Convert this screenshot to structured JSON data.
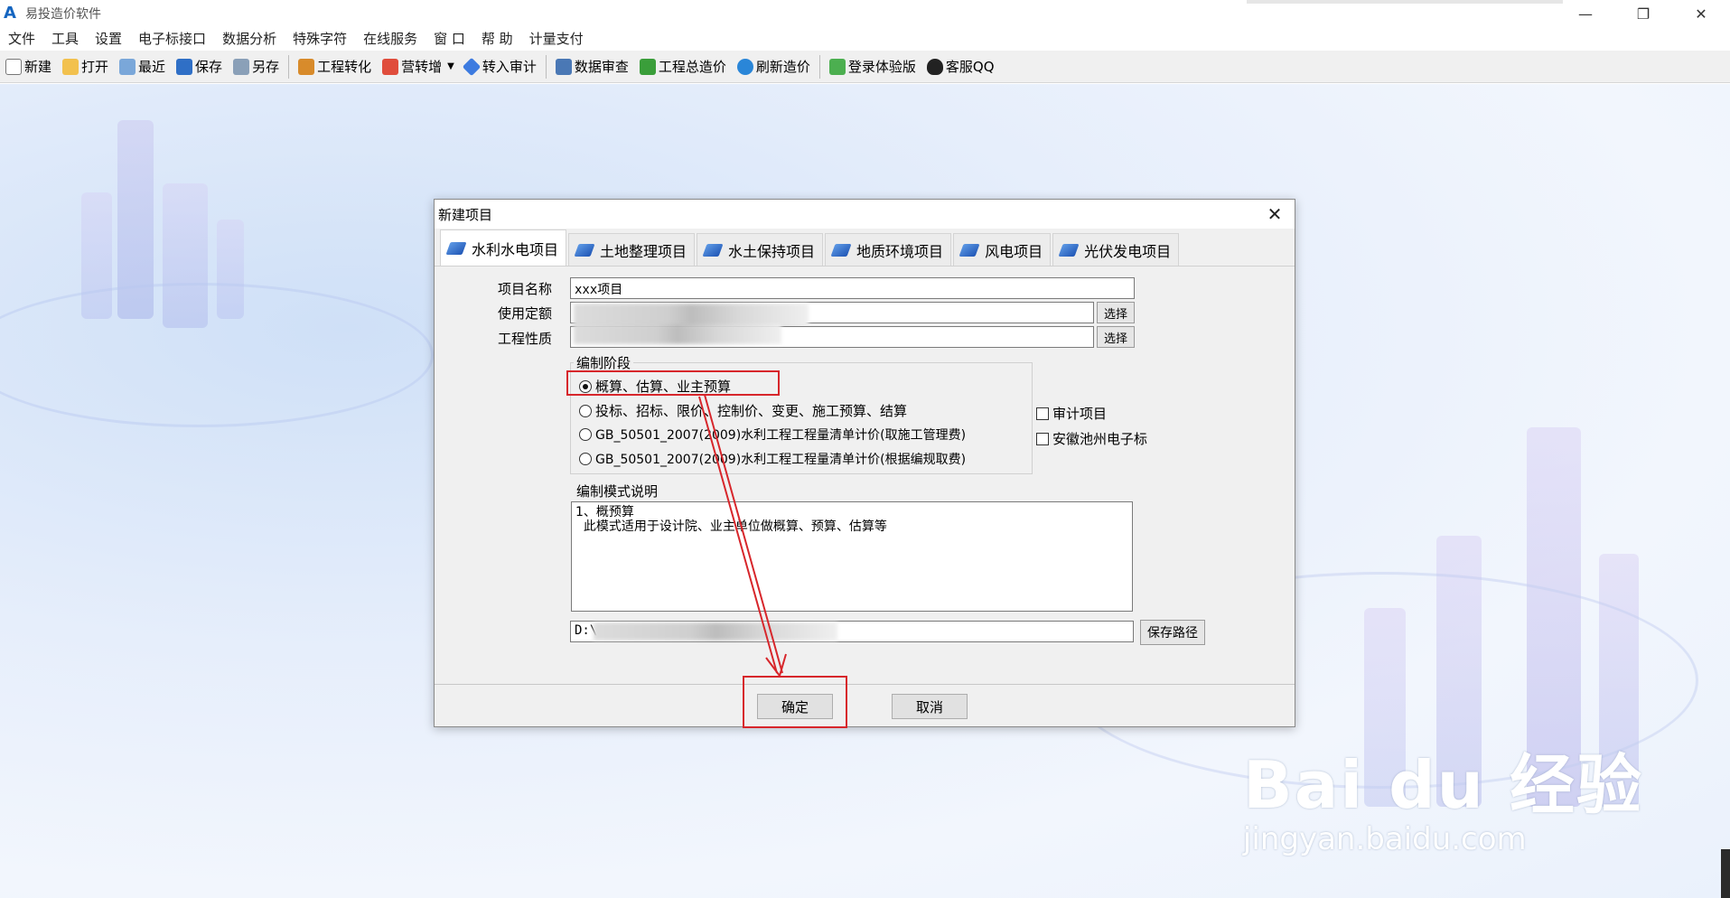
{
  "window": {
    "title": "易投造价软件",
    "logo_letter": "A",
    "minimize": "—",
    "restore": "❐",
    "close": "✕"
  },
  "menu": [
    "文件",
    "工具",
    "设置",
    "电子标接口",
    "数据分析",
    "特殊字符",
    "在线服务",
    "窗 口",
    "帮 助",
    "计量支付"
  ],
  "toolbar": {
    "new": "新建",
    "open": "打开",
    "recent": "最近",
    "save": "保存",
    "save_as": "另存",
    "convert": "工程转化",
    "vat": "营转增",
    "to_audit": "转入审计",
    "data_review": "数据审查",
    "total_cost": "工程总造价",
    "refresh": "刷新造价",
    "trial_login": "登录体验版",
    "support_qq": "客服QQ"
  },
  "dialog": {
    "title": "新建项目",
    "close": "✕",
    "tabs": [
      "水利水电项目",
      "土地整理项目",
      "水土保持项目",
      "地质环境项目",
      "风电项目",
      "光伏发电项目"
    ],
    "active_tab": 0,
    "labels": {
      "project_name": "项目名称",
      "quota": "使用定额",
      "nature": "工程性质"
    },
    "project_name_value": "xxx项目",
    "select_btn": "选择",
    "stage_group_title": "编制阶段",
    "stages": [
      "概算、估算、业主预算",
      "投标、招标、限价、控制价、变更、施工预算、结算",
      "GB_50501_2007(2009)水利工程工程量清单计价(取施工管理费)",
      "GB_50501_2007(2009)水利工程工程量清单计价(根据编规取费)"
    ],
    "selected_stage": 0,
    "checks": [
      "审计项目",
      "安徽池州电子标"
    ],
    "desc_group_title": "编制模式说明",
    "desc_text": "1、概预算\n  此模式适用于设计院、业主单位做概算、预算、估算等",
    "path_value": "D:\\",
    "save_path_btn": "保存路径",
    "ok": "确定",
    "cancel": "取消"
  },
  "colors": {
    "highlight": "#d7262b",
    "tab_icon": "#1f55b5"
  },
  "watermark": {
    "main": "Bai du 经验",
    "sub": "jingyan.baidu.com"
  }
}
